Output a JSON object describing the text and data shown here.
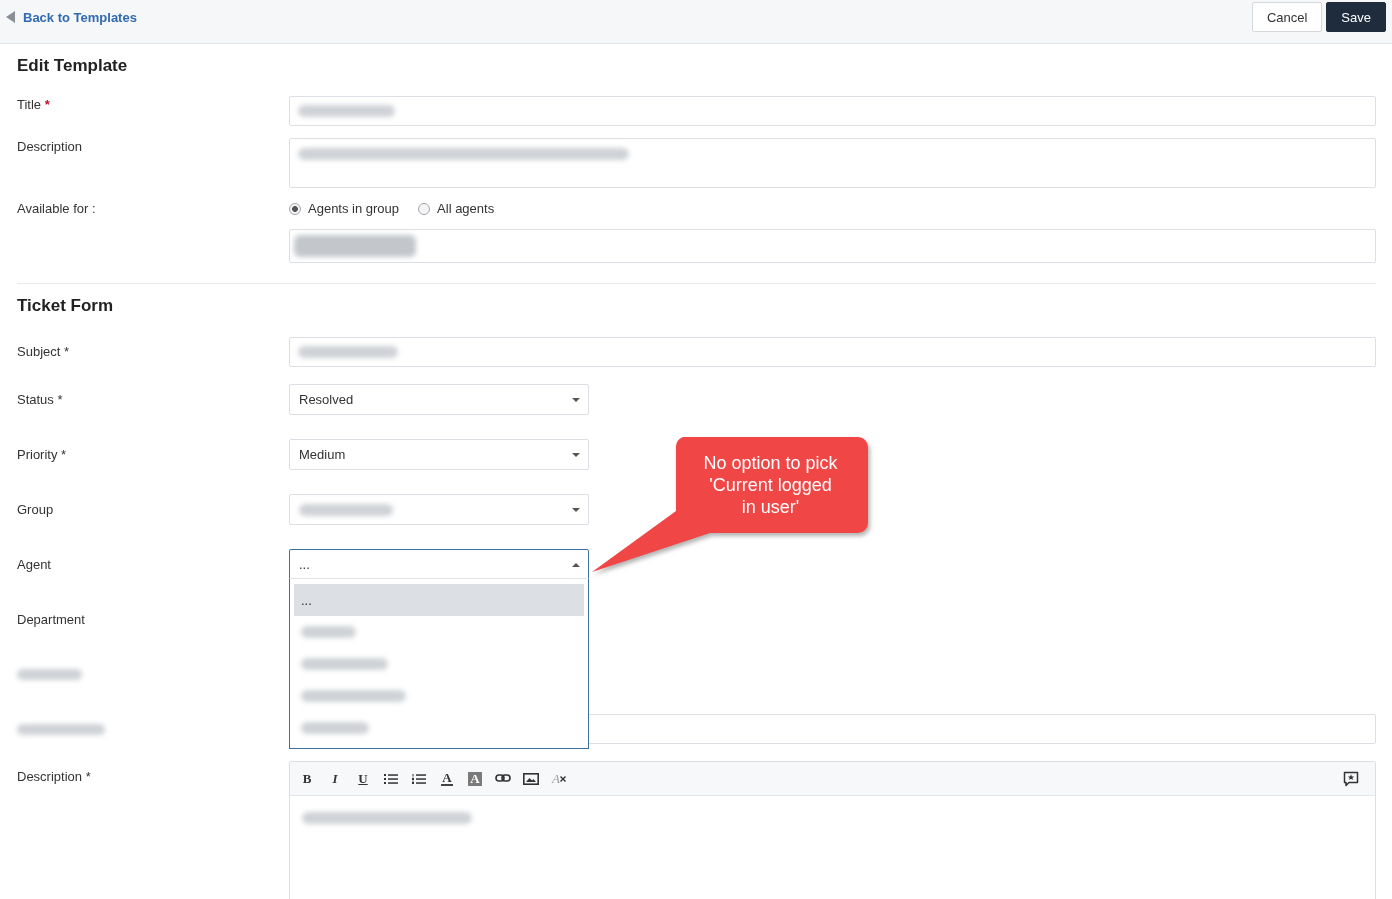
{
  "top_bar": {
    "back_link": "Back to Templates",
    "buttons": [
      {
        "label": "Cancel",
        "kind": "secondary"
      },
      {
        "label": "Save",
        "kind": "primary"
      }
    ]
  },
  "edit_template": {
    "heading": "Edit Template",
    "fields": [
      {
        "kind": "text",
        "label": "Title",
        "required_mark": "*",
        "value_blurred": true
      },
      {
        "kind": "textarea",
        "label": "Description",
        "value_blurred": true
      },
      {
        "kind": "audience",
        "label": "Available for :",
        "options": [
          {
            "label": "Agents in group",
            "selected": true
          },
          {
            "label": "All agents",
            "selected": false
          }
        ],
        "tags_blurred": true
      }
    ]
  },
  "ticket_form": {
    "heading": "Ticket Form",
    "fields": [
      {
        "kind": "text",
        "label": "Subject *",
        "value_blurred": true
      },
      {
        "kind": "select",
        "label": "Status *",
        "value": "Resolved",
        "expanded": false
      },
      {
        "kind": "select",
        "label": "Priority *",
        "value": "Medium",
        "expanded": false
      },
      {
        "kind": "select",
        "label": "Group",
        "value_blurred": true,
        "expanded": false
      },
      {
        "kind": "select",
        "label": "Agent",
        "value": "...",
        "expanded": true,
        "options": [
          {
            "label": "...",
            "selected": true
          },
          {
            "blurred": true,
            "selected": false
          },
          {
            "blurred": true,
            "selected": false
          },
          {
            "blurred": true,
            "selected": false
          },
          {
            "blurred": true,
            "selected": false
          }
        ]
      },
      {
        "kind": "covered",
        "label": "Department"
      },
      {
        "kind": "covered",
        "label_blurred": true
      },
      {
        "kind": "text",
        "label_blurred": true
      },
      {
        "kind": "editor",
        "label": "Description *",
        "toolbar": [
          {
            "kind": "bold",
            "glyph": "B"
          },
          {
            "kind": "italic",
            "glyph": "I"
          },
          {
            "kind": "underline",
            "glyph": "U"
          },
          {
            "kind": "bulleted_list"
          },
          {
            "kind": "numbered_list"
          },
          {
            "kind": "text_color",
            "glyph": "A"
          },
          {
            "kind": "highlight",
            "glyph": "A"
          },
          {
            "kind": "link"
          },
          {
            "kind": "image"
          },
          {
            "kind": "clear_format",
            "glyph": "A"
          }
        ],
        "toolbar_right": [
          {
            "kind": "canned_response"
          }
        ],
        "value_blurred": true
      }
    ]
  },
  "callout": {
    "lines": [
      "No option to pick",
      "'Current logged",
      "in user'"
    ]
  }
}
